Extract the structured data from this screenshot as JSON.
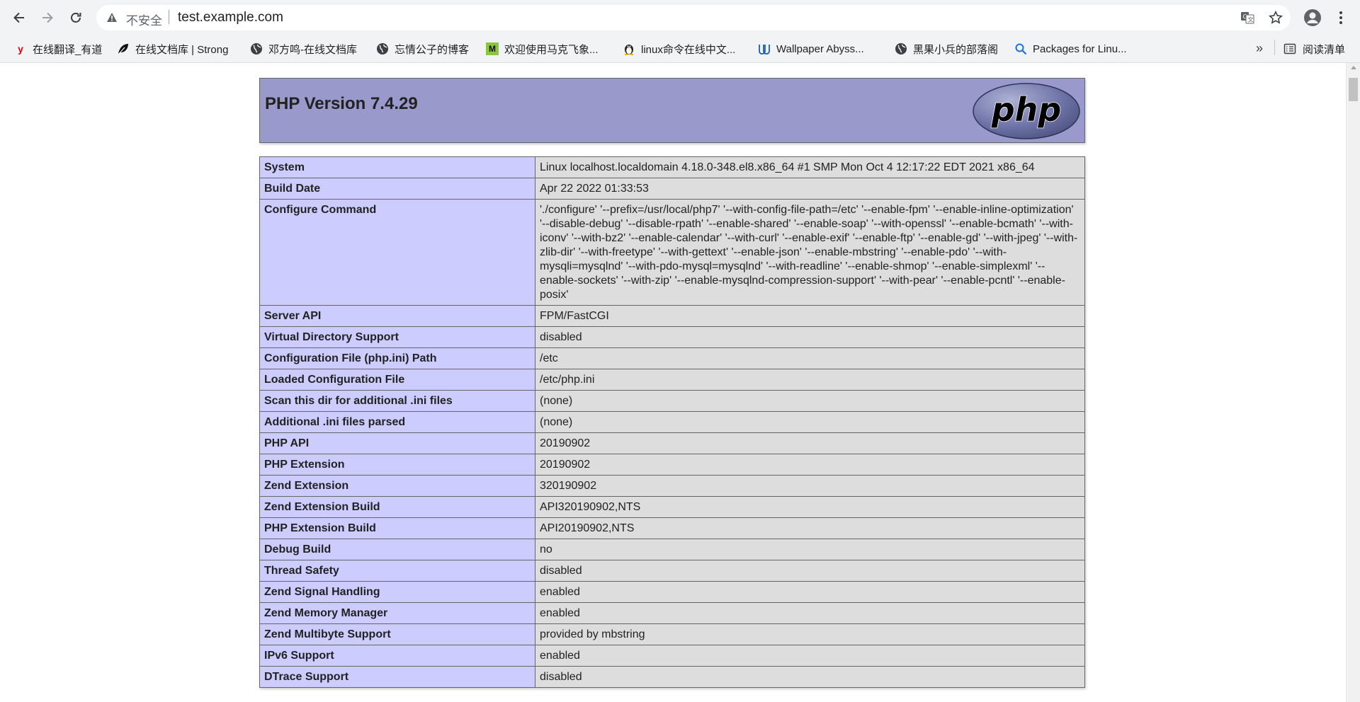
{
  "browser": {
    "security_label": "不安全",
    "url": "test.example.com",
    "bookmarks": [
      {
        "label": "在线翻译_有道",
        "icon": "youdao-icon"
      },
      {
        "label": "在线文档库 | Strong",
        "icon": "leaf-icon"
      },
      {
        "label": "邓方鸣-在线文档库",
        "icon": "globe-icon"
      },
      {
        "label": "忘情公子的博客",
        "icon": "globe-icon"
      },
      {
        "label": "欢迎使用马克飞象...",
        "icon": "maxiang-icon"
      },
      {
        "label": "linux命令在线中文...",
        "icon": "penguin-icon"
      },
      {
        "label": "Wallpaper Abyss...",
        "icon": "wallpaper-abyss-icon"
      },
      {
        "label": "黑果小兵的部落阁",
        "icon": "globe-icon"
      },
      {
        "label": "Packages for Linu...",
        "icon": "search-icon"
      }
    ],
    "more_bookmarks": "»",
    "reading_list": "阅读清单"
  },
  "phpinfo": {
    "title": "PHP Version 7.4.29",
    "logo_text": "php",
    "rows": [
      {
        "key": "System",
        "value": "Linux localhost.localdomain 4.18.0-348.el8.x86_64 #1 SMP Mon Oct 4 12:17:22 EDT 2021 x86_64"
      },
      {
        "key": "Build Date",
        "value": "Apr 22 2022 01:33:53"
      },
      {
        "key": "Configure Command",
        "value": "'./configure' '--prefix=/usr/local/php7' '--with-config-file-path=/etc' '--enable-fpm' '--enable-inline-optimization' '--disable-debug' '--disable-rpath' '--enable-shared' '--enable-soap' '--with-openssl' '--enable-bcmath' '--with-iconv' '--with-bz2' '--enable-calendar' '--with-curl' '--enable-exif' '--enable-ftp' '--enable-gd' '--with-jpeg' '--with-zlib-dir' '--with-freetype' '--with-gettext' '--enable-json' '--enable-mbstring' '--enable-pdo' '--with-mysqli=mysqlnd' '--with-pdo-mysql=mysqlnd' '--with-readline' '--enable-shmop' '--enable-simplexml' '--enable-sockets' '--with-zip' '--enable-mysqlnd-compression-support' '--with-pear' '--enable-pcntl' '--enable-posix'"
      },
      {
        "key": "Server API",
        "value": "FPM/FastCGI"
      },
      {
        "key": "Virtual Directory Support",
        "value": "disabled"
      },
      {
        "key": "Configuration File (php.ini) Path",
        "value": "/etc"
      },
      {
        "key": "Loaded Configuration File",
        "value": "/etc/php.ini"
      },
      {
        "key": "Scan this dir for additional .ini files",
        "value": "(none)"
      },
      {
        "key": "Additional .ini files parsed",
        "value": "(none)"
      },
      {
        "key": "PHP API",
        "value": "20190902"
      },
      {
        "key": "PHP Extension",
        "value": "20190902"
      },
      {
        "key": "Zend Extension",
        "value": "320190902"
      },
      {
        "key": "Zend Extension Build",
        "value": "API320190902,NTS"
      },
      {
        "key": "PHP Extension Build",
        "value": "API20190902,NTS"
      },
      {
        "key": "Debug Build",
        "value": "no"
      },
      {
        "key": "Thread Safety",
        "value": "disabled"
      },
      {
        "key": "Zend Signal Handling",
        "value": "enabled"
      },
      {
        "key": "Zend Memory Manager",
        "value": "enabled"
      },
      {
        "key": "Zend Multibyte Support",
        "value": "provided by mbstring"
      },
      {
        "key": "IPv6 Support",
        "value": "enabled"
      },
      {
        "key": "DTrace Support",
        "value": "disabled"
      }
    ]
  }
}
